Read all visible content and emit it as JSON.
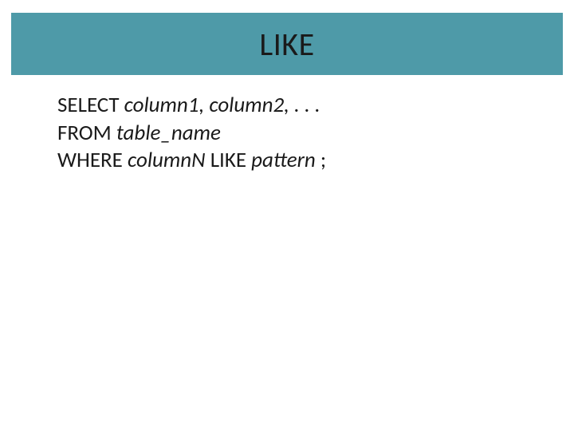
{
  "title": "LIKE",
  "code": {
    "line1": {
      "keyword": "SELECT",
      "rest": "column1, column2, . . ."
    },
    "line2": {
      "keyword": "FROM",
      "rest": "table_name"
    },
    "line3": {
      "keyword": "WHERE",
      "rest_part1": "columnN",
      "keyword2": "LIKE",
      "rest_part2": "pattern",
      "end": ";"
    }
  }
}
